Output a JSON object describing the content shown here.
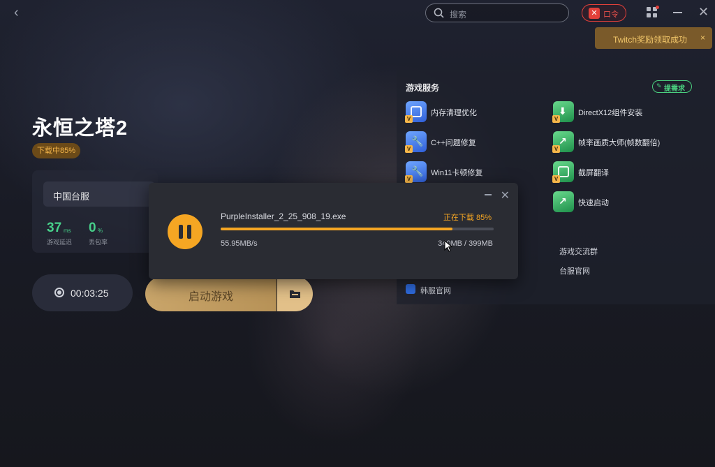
{
  "topbar": {
    "search_placeholder": "搜索",
    "command_label": "口令",
    "icons": [
      "back-arrow-icon",
      "search-icon",
      "command-icon",
      "apps-grid-icon",
      "minimize-icon",
      "close-icon"
    ]
  },
  "toast": {
    "message": "Twitch奖励领取成功",
    "close": "×"
  },
  "game": {
    "title": "永恒之塔2",
    "status_badge": "下载中85%",
    "server": "中国台服",
    "ping_value": "37",
    "ping_unit": "ms",
    "ping_label": "游戏延迟",
    "loss_value": "0",
    "loss_unit": "%",
    "loss_label": "丢包率",
    "timer": "00:03:25",
    "launch_label": "启动游戏"
  },
  "services": {
    "heading": "游戏服务",
    "request_label": "提需求",
    "items": [
      {
        "label": "内存清理优化",
        "icon": "memory-clean-icon",
        "color": "blue"
      },
      {
        "label": "DirectX12组件安装",
        "icon": "directx-install-icon",
        "color": "green"
      },
      {
        "label": "C++问题修复",
        "icon": "cpp-repair-icon",
        "color": "blue"
      },
      {
        "label": "帧率画质大师(帧数翻倍)",
        "icon": "framerate-master-icon",
        "color": "green"
      },
      {
        "label": "Win11卡顿修复",
        "icon": "win11-repair-icon",
        "color": "blue"
      },
      {
        "label": "截屏翻译",
        "icon": "screenshot-translate-icon",
        "color": "green"
      },
      {
        "label": "快速启动",
        "icon": "quick-launch-icon",
        "color": "green"
      }
    ],
    "links": {
      "community": "游戏交流群",
      "tw_official": "台服官网",
      "kr_official": "韩服官网"
    }
  },
  "download": {
    "filename": "PurpleInstaller_2_25_908_19.exe",
    "status": "正在下载 85%",
    "progress": 0.85,
    "speed": "55.95MB/s",
    "size": "340MB / 399MB"
  },
  "colors": {
    "accent": "#f5a623",
    "ping_green": "#47d08a",
    "command_red": "#e2403a",
    "request_green": "#4ad07f"
  }
}
